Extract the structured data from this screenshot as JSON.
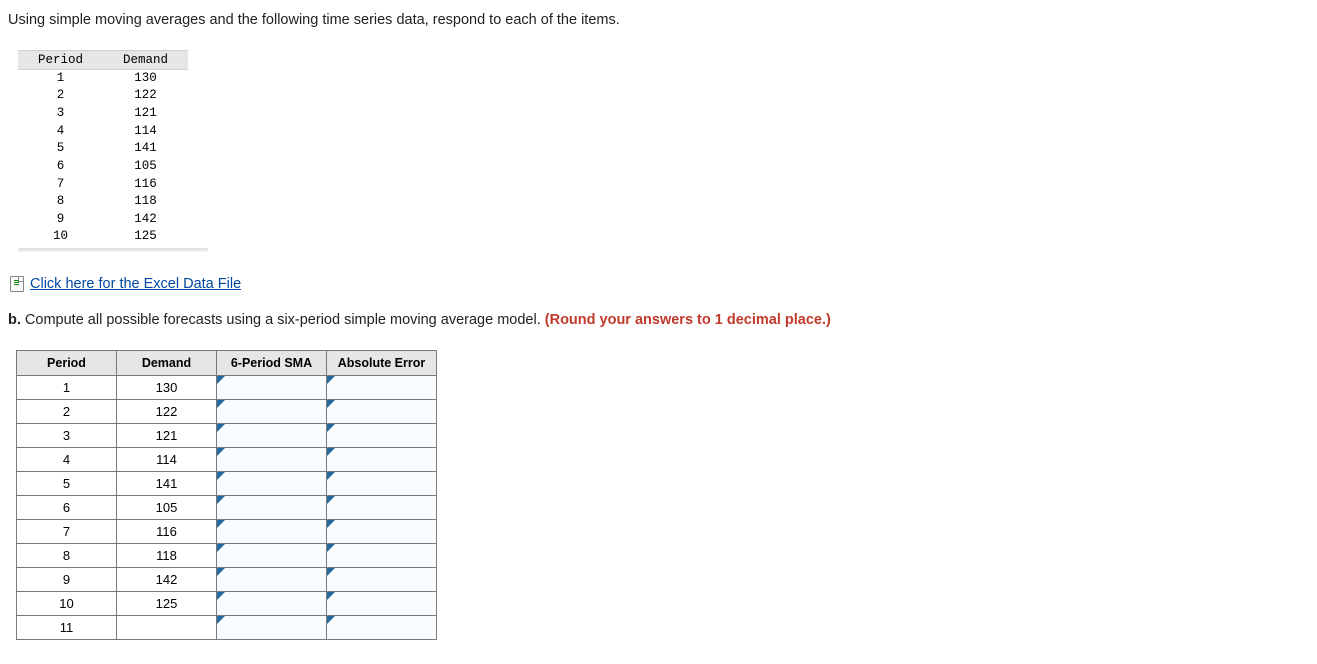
{
  "intro": "Using simple moving averages and the following time series data, respond to each of the items.",
  "data_table": {
    "headers": {
      "period": "Period",
      "demand": "Demand"
    },
    "rows": [
      {
        "period": "1",
        "demand": "130"
      },
      {
        "period": "2",
        "demand": "122"
      },
      {
        "period": "3",
        "demand": "121"
      },
      {
        "period": "4",
        "demand": "114"
      },
      {
        "period": "5",
        "demand": "141"
      },
      {
        "period": "6",
        "demand": "105"
      },
      {
        "period": "7",
        "demand": "116"
      },
      {
        "period": "8",
        "demand": "118"
      },
      {
        "period": "9",
        "demand": "142"
      },
      {
        "period": "10",
        "demand": "125"
      }
    ]
  },
  "excel_link": {
    "label": " Click here for the Excel Data File"
  },
  "question": {
    "label": "b.",
    "text": "Compute all possible forecasts using a six-period simple moving average model.",
    "emphasis": "(Round your answers to 1 decimal place.)"
  },
  "answer_table": {
    "headers": {
      "period": "Period",
      "demand": "Demand",
      "sma": "6-Period SMA",
      "err": "Absolute Error"
    },
    "rows": [
      {
        "period": "1",
        "demand": "130",
        "sma": "",
        "err": ""
      },
      {
        "period": "2",
        "demand": "122",
        "sma": "",
        "err": ""
      },
      {
        "period": "3",
        "demand": "121",
        "sma": "",
        "err": ""
      },
      {
        "period": "4",
        "demand": "114",
        "sma": "",
        "err": ""
      },
      {
        "period": "5",
        "demand": "141",
        "sma": "",
        "err": ""
      },
      {
        "period": "6",
        "demand": "105",
        "sma": "",
        "err": ""
      },
      {
        "period": "7",
        "demand": "116",
        "sma": "",
        "err": ""
      },
      {
        "period": "8",
        "demand": "118",
        "sma": "",
        "err": ""
      },
      {
        "period": "9",
        "demand": "142",
        "sma": "",
        "err": ""
      },
      {
        "period": "10",
        "demand": "125",
        "sma": "",
        "err": ""
      },
      {
        "period": "11",
        "demand": "",
        "sma": "",
        "err": ""
      }
    ]
  }
}
